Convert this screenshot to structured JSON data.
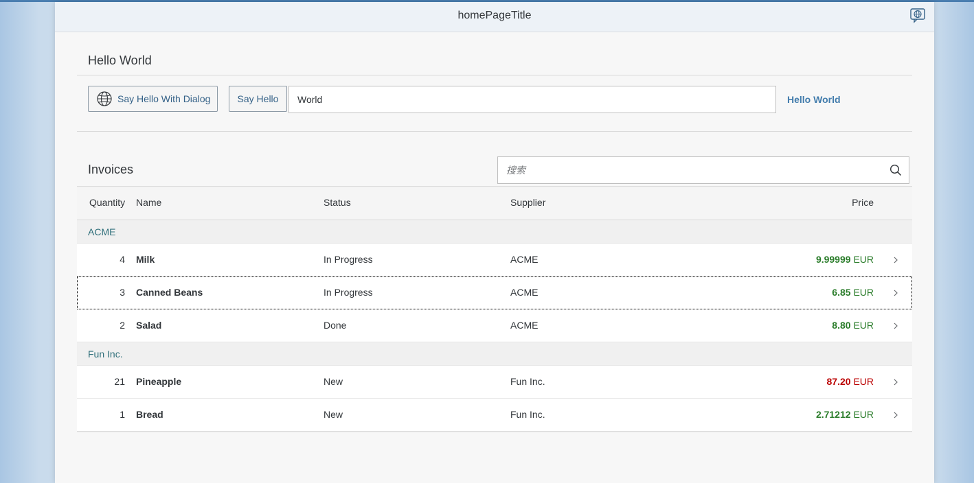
{
  "header": {
    "title": "homePageTitle",
    "icon": "globe-icon"
  },
  "panel": {
    "title": "Hello World",
    "dialog_button_label": "Say Hello With Dialog",
    "hello_button_label": "Say Hello",
    "name_input_value": "World",
    "hello_link_text": "Hello World"
  },
  "invoices": {
    "title": "Invoices",
    "search_placeholder": "搜索",
    "columns": [
      "Quantity",
      "Name",
      "Status",
      "Supplier",
      "Price"
    ],
    "groups": [
      {
        "label": "ACME",
        "rows": [
          {
            "quantity": "4",
            "name": "Milk",
            "status": "In Progress",
            "supplier": "ACME",
            "price": "9.99999",
            "currency": "EUR",
            "state": "success"
          },
          {
            "quantity": "3",
            "name": "Canned Beans",
            "status": "In Progress",
            "supplier": "ACME",
            "price": "6.85",
            "currency": "EUR",
            "state": "success"
          },
          {
            "quantity": "2",
            "name": "Salad",
            "status": "Done",
            "supplier": "ACME",
            "price": "8.80",
            "currency": "EUR",
            "state": "success"
          }
        ]
      },
      {
        "label": "Fun Inc.",
        "rows": [
          {
            "quantity": "21",
            "name": "Pineapple",
            "status": "New",
            "supplier": "Fun Inc.",
            "price": "87.20",
            "currency": "EUR",
            "state": "error"
          },
          {
            "quantity": "1",
            "name": "Bread",
            "status": "New",
            "supplier": "Fun Inc.",
            "price": "2.71212",
            "currency": "EUR",
            "state": "success"
          }
        ]
      }
    ]
  },
  "colors": {
    "success": "#2b7d2b",
    "error": "#bb0000",
    "link": "#427cac",
    "group_text": "#2f6f7a"
  }
}
